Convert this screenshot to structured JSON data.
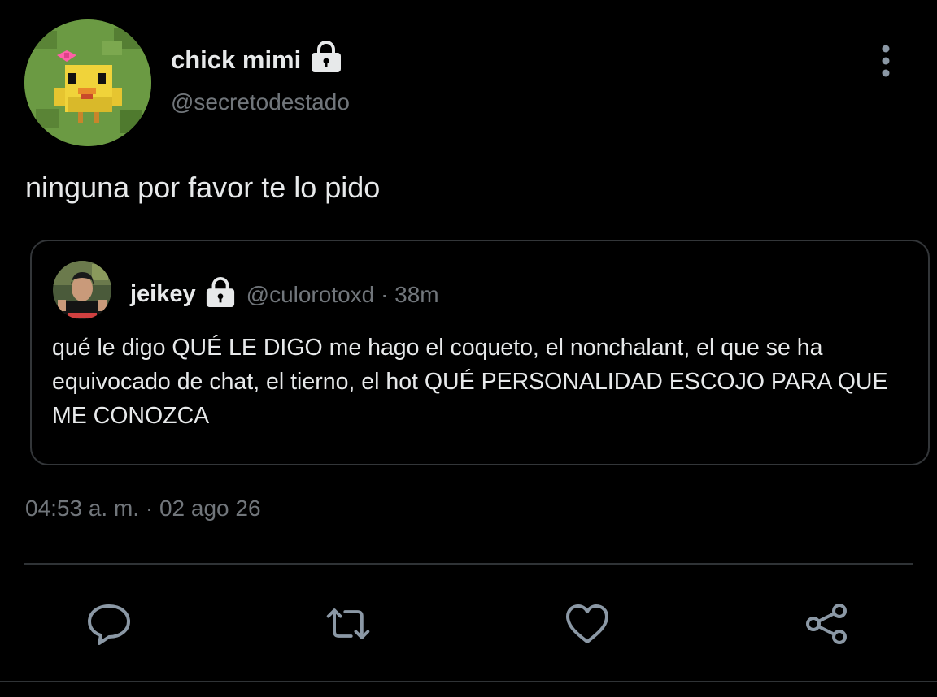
{
  "author": {
    "display_name": "chick mimi",
    "handle": "@secretodestado",
    "avatar": "minecraft-chick-avatar",
    "protected_icon": "lock-icon"
  },
  "tweet": {
    "text": "ninguna por favor te lo pido",
    "timestamp": "04:53 a. m. · 02 ago 26"
  },
  "quoted_tweet": {
    "display_name": "jeikey",
    "handle_time": "@culorotoxd · 38m",
    "avatar": "person-photo-avatar",
    "protected_icon": "lock-icon",
    "text": "qué le digo QUÉ LE DIGO me hago el coqueto, el nonchalant, el que se ha equivocado de chat, el tierno, el hot QUÉ PERSONALIDAD ESCOJO PARA QUE ME CONOZCA"
  },
  "actions": [
    {
      "name": "reply",
      "icon": "speech-bubble-icon"
    },
    {
      "name": "retweet",
      "icon": "retweet-arrows-icon"
    },
    {
      "name": "like",
      "icon": "heart-icon"
    },
    {
      "name": "share",
      "icon": "share-icon"
    }
  ],
  "menu": {
    "icon": "vertical-dots-icon"
  },
  "colors": {
    "background": "#000000",
    "primary_text": "#e7e9ea",
    "secondary_text": "#71767b",
    "border": "#333639",
    "icon": "#8b98a5"
  }
}
